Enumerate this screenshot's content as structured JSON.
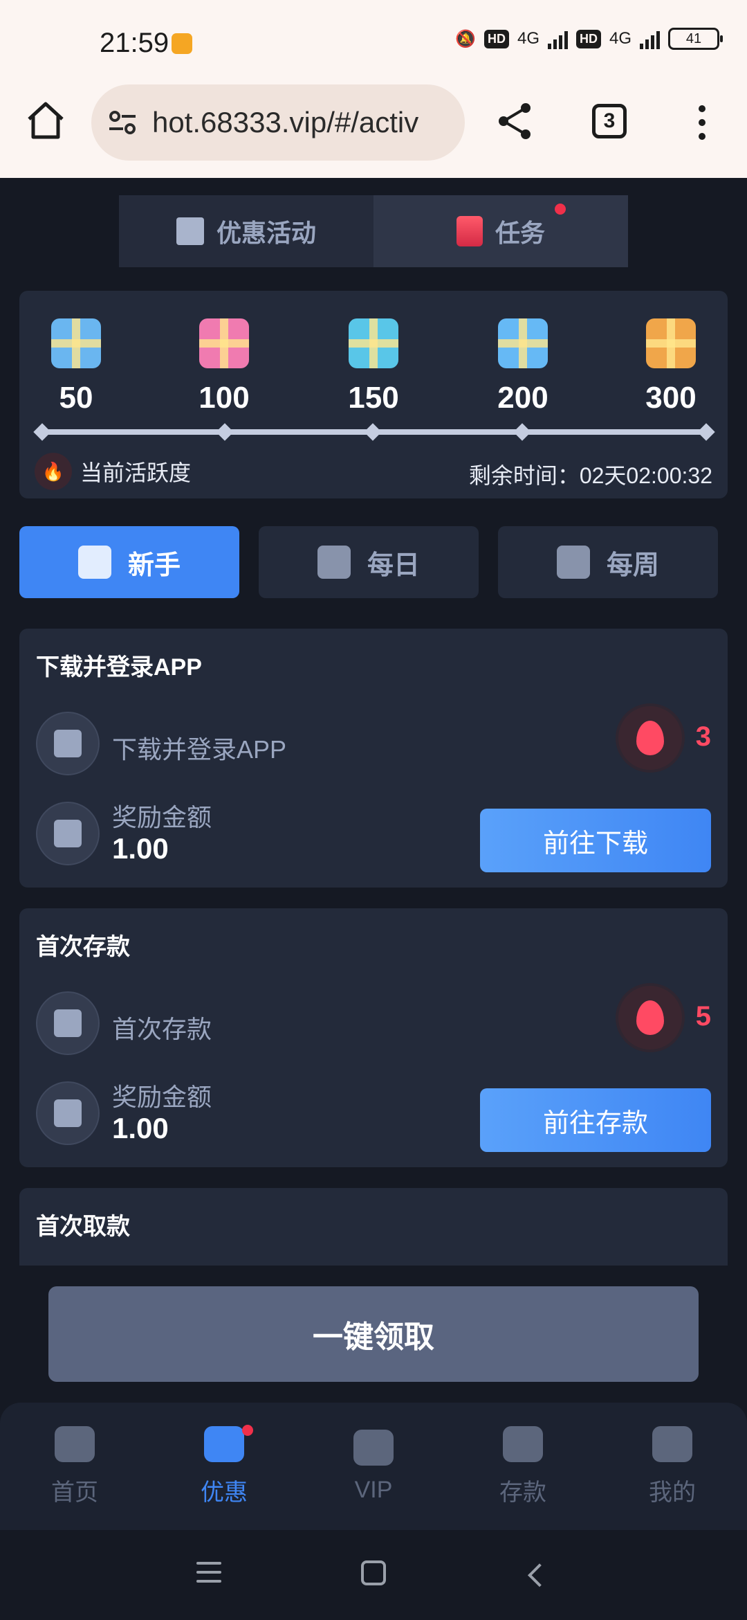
{
  "status_bar": {
    "time": "21:59",
    "network_1": "4G",
    "network_2": "4G",
    "hd_1": "HD",
    "hd_2": "HD",
    "battery": "41"
  },
  "browser": {
    "url": "hot.68333.vip/#/activ",
    "tab_count": "3"
  },
  "top_tabs": {
    "promotions_label": "优惠活动",
    "tasks_label": "任务"
  },
  "activity": {
    "milestones": [
      {
        "value": "50",
        "color": "#6ab6f0"
      },
      {
        "value": "100",
        "color": "#f07bb0"
      },
      {
        "value": "150",
        "color": "#59c6e8"
      },
      {
        "value": "200",
        "color": "#66b9f5"
      },
      {
        "value": "300",
        "color": "#f0a64a"
      }
    ],
    "current_label": "当前活跃度",
    "remaining_time_label": "剩余时间：02天02:00:32"
  },
  "sub_tabs": [
    {
      "label": "新手",
      "active": true
    },
    {
      "label": "每日",
      "active": false
    },
    {
      "label": "每周",
      "active": false
    }
  ],
  "tasks": [
    {
      "title": "下载并登录APP",
      "name": "下载并登录APP",
      "points": "3",
      "reward_label": "奖励金额",
      "reward_value": "1.00",
      "button_label": "前往下载"
    },
    {
      "title": "首次存款",
      "name": "首次存款",
      "points": "5",
      "reward_label": "奖励金额",
      "reward_value": "1.00",
      "button_label": "前往存款"
    },
    {
      "title": "首次取款"
    }
  ],
  "claim_all_label": "一键领取",
  "bottom_nav": [
    {
      "label": "首页",
      "active": false
    },
    {
      "label": "优惠",
      "active": true
    },
    {
      "label": "VIP",
      "active": false
    },
    {
      "label": "存款",
      "active": false
    },
    {
      "label": "我的",
      "active": false
    }
  ],
  "colors": {
    "accent": "#3f86f4",
    "background": "#151923",
    "card": "#232a3a",
    "fire": "#ff4a63"
  }
}
